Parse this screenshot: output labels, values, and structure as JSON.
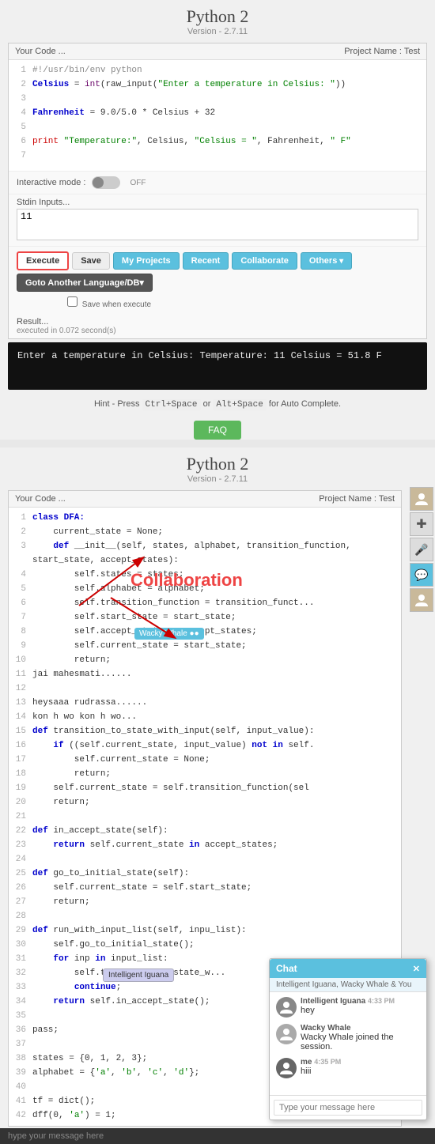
{
  "top": {
    "title": "Python 2",
    "subtitle": "Version - 2.7.11",
    "editor_header": {
      "left": "Your Code ...",
      "right": "Project Name : Test"
    },
    "code_lines": [
      {
        "num": "1",
        "code": "#!/usr/bin/env python"
      },
      {
        "num": "2",
        "code": "Celsius = int(raw_input(\"Enter a temperature in Celsius: \"))"
      },
      {
        "num": "3",
        "code": ""
      },
      {
        "num": "4",
        "code": "Fahrenheit = 9.0/5.0 * Celsius + 32"
      },
      {
        "num": "5",
        "code": ""
      },
      {
        "num": "6",
        "code": "print \"Temperature:\", Celsius, \"Celsius = \", Fahrenheit, \" F\""
      },
      {
        "num": "7",
        "code": ""
      }
    ],
    "interactive_label": "Interactive mode :",
    "toggle_state": "OFF",
    "stdin_label": "Stdin Inputs...",
    "stdin_value": "11",
    "buttons": {
      "execute": "Execute",
      "save": "Save",
      "my_projects": "My Projects",
      "recent": "Recent",
      "collaborate": "Collaborate",
      "others": "Others",
      "goto": "Goto Another Language/DB▾"
    },
    "save_when_execute": "Save when execute",
    "result_label": "Result...",
    "exec_time": "executed in 0.072 second(s)",
    "output": "Enter a temperature in Celsius: Temperature: 11 Celsius = 51.8  F",
    "hint": "Hint - Press Ctrl+Space or Alt+Space for Auto Complete.",
    "faq": "FAQ"
  },
  "bottom": {
    "title": "Python 2",
    "subtitle": "Version - 2.7.11",
    "editor_header": {
      "left": "Your Code ...",
      "right": "Project Name : Test"
    },
    "code_lines": [
      {
        "num": "1",
        "code": "class DFA:"
      },
      {
        "num": "2",
        "code": "    current_state = None;"
      },
      {
        "num": "3",
        "code": "    def __init__(self, states, alphabet, transition_function, start_state, accept_states):"
      },
      {
        "num": "4",
        "code": "        self.states = states;"
      },
      {
        "num": "5",
        "code": "        self.alphabet = alphabet;"
      },
      {
        "num": "6",
        "code": "        self.transition_function = transition_funct..."
      },
      {
        "num": "7",
        "code": "        self.start_state = start_state;"
      },
      {
        "num": "8",
        "code": "        self.accept_states = accept_states;"
      },
      {
        "num": "9",
        "code": "        self.current_state = start_state;"
      },
      {
        "num": "10",
        "code": "        return;"
      },
      {
        "num": "11",
        "code": "jai mahesmati......"
      },
      {
        "num": "12",
        "code": ""
      },
      {
        "num": "13",
        "code": "heysaaa rudrassa......"
      },
      {
        "num": "14",
        "code": "kon h wo kon h wo..."
      },
      {
        "num": "15",
        "code": "def transition_to_state_with_input(self, input_value):"
      },
      {
        "num": "16",
        "code": "    if ((self.current_state, input_value) not in self."
      },
      {
        "num": "17",
        "code": "        self.current_state = None;"
      },
      {
        "num": "18",
        "code": "        return;"
      },
      {
        "num": "19",
        "code": "    self.current_state = self.transition_function(sel"
      },
      {
        "num": "20",
        "code": "    return;"
      },
      {
        "num": "21",
        "code": ""
      },
      {
        "num": "22",
        "code": "def in_accept_state(self):"
      },
      {
        "num": "23",
        "code": "    return self.current_state in accept_states;"
      },
      {
        "num": "24",
        "code": ""
      },
      {
        "num": "25",
        "code": "def go_to_initial_state(self):"
      },
      {
        "num": "26",
        "code": "    self.current_state = self.start_state;"
      },
      {
        "num": "27",
        "code": "    return;"
      },
      {
        "num": "28",
        "code": ""
      },
      {
        "num": "29",
        "code": "def run_with_input_list(self, inpu_list):"
      },
      {
        "num": "30",
        "code": "    self.go_to_initial_state();"
      },
      {
        "num": "31",
        "code": "    for inp in input_list:"
      },
      {
        "num": "32",
        "code": "        self.transition_to_state_w..."
      },
      {
        "num": "33",
        "code": "        continue;"
      },
      {
        "num": "34",
        "code": "    return self.in_accept_state();"
      },
      {
        "num": "35",
        "code": ""
      },
      {
        "num": "36",
        "code": "pass;"
      },
      {
        "num": "37",
        "code": ""
      },
      {
        "num": "38",
        "code": "states = {0, 1, 2, 3};"
      },
      {
        "num": "39",
        "code": "alphabet = {'a', 'b', 'c', 'd'};"
      },
      {
        "num": "40",
        "code": ""
      },
      {
        "num": "41",
        "code": "tf = dict();"
      },
      {
        "num": "42",
        "code": "dff(0, 'a') = 1;"
      }
    ],
    "collab_label": "Collaboration",
    "whale_badge": "Wacky Whale ●●",
    "iguana_badge": "Intelligent Iguana",
    "chat": {
      "title": "Chat",
      "participants": "Intelligent Iguana, Wacky Whale & You",
      "messages": [
        {
          "sender": "Intelligent Iguana",
          "text": "hey",
          "time": "4:33 PM",
          "avatar_color": "#888"
        },
        {
          "sender": "Wacky Whale",
          "text": "Wacky Whale joined the session.",
          "time": "",
          "avatar_color": "#aaa"
        },
        {
          "sender": "me",
          "text": "hiii",
          "time": "4:35 PM",
          "avatar_color": "#666"
        }
      ],
      "input_placeholder": "Type your message here"
    },
    "sidebar_icons": [
      "👤",
      "✚",
      "🎤",
      "💬",
      "👤"
    ]
  },
  "bottom_bar": {
    "hype_text": "hype your message here"
  }
}
